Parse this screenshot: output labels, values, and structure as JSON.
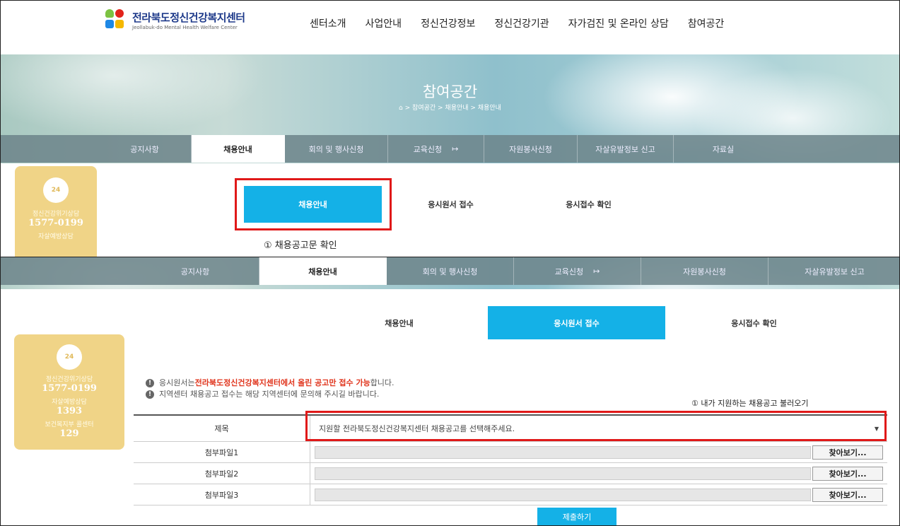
{
  "header": {
    "logo_title": "전라북도정신건강복지센터",
    "logo_subtitle": "Jeollabuk-do Mental Health Welfare Center",
    "nav": [
      "센터소개",
      "사업안내",
      "정신건강정보",
      "정신건강기관",
      "자가검진 및 온라인 상담",
      "참여공간"
    ]
  },
  "hero": {
    "title": "참여공간",
    "breadcrumb": "> 참여공간 > 채용안내 > 채용안내"
  },
  "subnav": [
    "공지사항",
    "채용안내",
    "회의 및 행사신청",
    "교육신청",
    "자원봉사신청",
    "자살유발정보 신고",
    "자료실"
  ],
  "subnav2": [
    "공지사항",
    "채용안내",
    "회의 및 행사신청",
    "교육신청",
    "자원봉사신청",
    "자살유발정보 신고"
  ],
  "side": {
    "badge": "24",
    "items": [
      {
        "label": "정신건강위기상담",
        "number": "1577-0199"
      },
      {
        "label": "자살예방상담",
        "number": "1393"
      },
      {
        "label": "보건복지부 콜센터",
        "number": "129"
      }
    ]
  },
  "tabs": [
    "채용안내",
    "응시원서 접수",
    "응시접수 확인"
  ],
  "captions": {
    "step1": "① 채용공고문 확인",
    "step2": "① 내가 지원하는 채용공고 불러오기"
  },
  "notices": {
    "line1_pre": "응시원서는 ",
    "line1_highlight": "전라북도정신건강복지센터에서 올린 공고만 접수 가능",
    "line1_post": "합니다.",
    "line2": "지역센터 채용공고 접수는 해당 지역센터에 문의해 주시길 바랍니다."
  },
  "form": {
    "title_label": "제목",
    "select_placeholder": "지원할 전라북도정신건강복지센터 채용공고를 선택해주세요.",
    "files": [
      {
        "label": "첨부파일1",
        "button": "찾아보기..."
      },
      {
        "label": "첨부파일2",
        "button": "찾아보기..."
      },
      {
        "label": "첨부파일3",
        "button": "찾아보기..."
      }
    ],
    "submit": "제출하기"
  },
  "colors": {
    "accent": "#14b1e7",
    "highlight": "#e01919",
    "side_bg": "#f0d487"
  }
}
